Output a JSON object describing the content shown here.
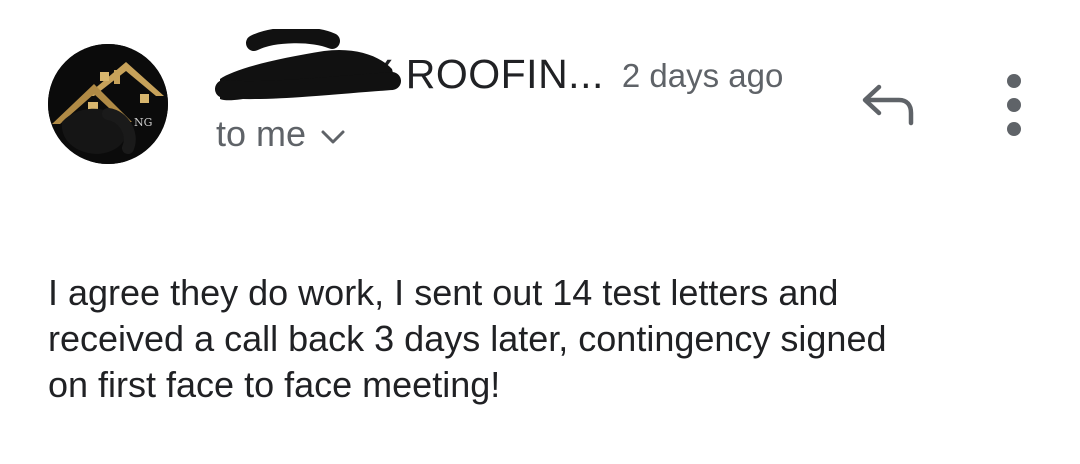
{
  "email": {
    "sender": {
      "name_visible": "X ROOFIN...",
      "avatar_icon": "roofing-house-logo-icon",
      "avatar_logo_text": "NG"
    },
    "timestamp": "2 days ago",
    "recipient": {
      "label": "to me",
      "expand_icon": "chevron-down-icon"
    },
    "actions": {
      "reply_icon": "reply-arrow-icon",
      "more_icon": "more-vertical-icon"
    },
    "body_lines": [
      "I agree they do work, I sent out 14 test letters and",
      "received a call back 3 days later, contingency signed",
      "on first face to face meeting!"
    ]
  },
  "colors": {
    "text_primary": "#202124",
    "text_secondary": "#5f6368",
    "redaction": "#111111",
    "logo_gold": "#c7a25a"
  }
}
